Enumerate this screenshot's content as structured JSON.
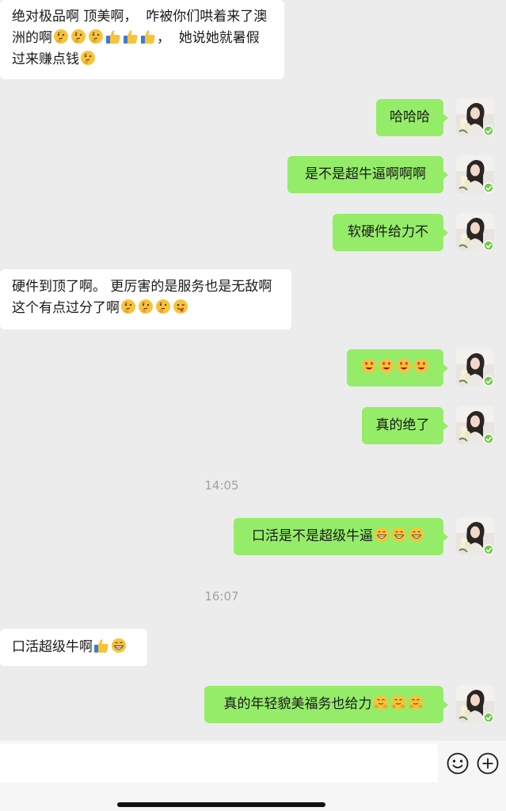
{
  "messages": {
    "m1_text": "绝对极品啊 顶美啊，  咋被你们哄着来了澳洲的啊",
    "m1_text_b": "，  她说她就暑假过来赚点钱",
    "m2_text": "哈哈哈",
    "m3_text": "是不是超牛逼啊啊啊",
    "m4_text": "软硬件给力不",
    "m5_text": "硬件到顶了啊。 更厉害的是服务也是无敌啊 这个有点过分了啊",
    "m7_text": "真的绝了",
    "m8_text": "口活是不是超级牛逼",
    "m9_text": "口活超级牛啊",
    "m10_text": "真的年轻貌美福务也给力"
  },
  "timestamps": {
    "t1": "14:05",
    "t2": "16:07"
  },
  "icons": {
    "thinking": "thinking-face-emoji",
    "thumbs": "thumbs-up-emoji",
    "heart_eyes": "heart-eyes-emoji",
    "wink": "winking-tongue-emoji",
    "grin": "grinning-emoji",
    "hug": "hugging-face-emoji",
    "emoji_button": "smiley-icon",
    "plus_button": "plus-icon"
  },
  "colors": {
    "outgoing_bubble": "#95ec69",
    "incoming_bubble": "#ffffff",
    "chat_background": "#ececec"
  }
}
